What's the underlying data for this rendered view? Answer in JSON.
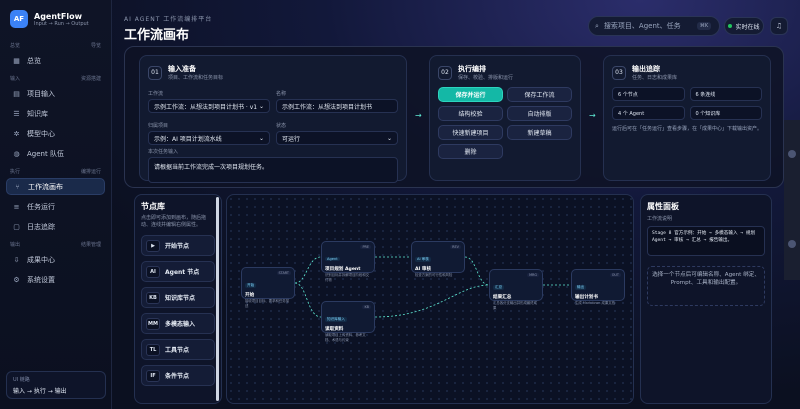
{
  "brand": {
    "logo": "AF",
    "name": "AgentFlow",
    "subtitle": "Input → Run → Output"
  },
  "nav": {
    "group1": {
      "label": "总览",
      "right": "导览"
    },
    "item_overview": "总览",
    "group2": {
      "label": "输入",
      "right": "资源搭建"
    },
    "item_project_input": "项目输入",
    "item_kb": "知识库",
    "item_models": "模型中心",
    "item_agents": "Agent 队伍",
    "group3": {
      "label": "执行",
      "right": "编排运行"
    },
    "item_canvas": "工作流画布",
    "item_tasks": "任务运行",
    "item_logs": "日志追踪",
    "group4": {
      "label": "输出",
      "right": "结果管理"
    },
    "item_results": "成果中心",
    "item_settings": "系统设置",
    "ui_box": {
      "label": "UI 链路",
      "value": "输入 → 执行 → 输出"
    }
  },
  "header": {
    "kicker": "AI AGENT 工作流编排平台",
    "title": "工作流画布",
    "search_placeholder": "搜索项目、Agent、任务",
    "kbd": "⌘K",
    "status": "实时在线"
  },
  "step1": {
    "num": "01",
    "title": "输入准备",
    "sub": "项目、工作流和任务目标",
    "workflow_label": "工作流",
    "workflow_value": "示例工作流：从想法到项目计划书 · v1",
    "name_label": "名称",
    "name_value": "示例工作流：从想法到项目计划书",
    "project_label": "归属项目",
    "project_value": "示例：AI 项目计划流水线",
    "state_label": "状态",
    "state_value": "可运行",
    "task_label": "本次任务输入",
    "task_value": "请根据当前工作流完成一次项目规划任务。"
  },
  "step2": {
    "num": "02",
    "title": "执行编排",
    "sub": "保存、校验、排版和运行",
    "buttons": [
      "保存并运行",
      "保存工作流",
      "结构校验",
      "自动排版",
      "快速新建项目",
      "新建草稿",
      "删除"
    ]
  },
  "step3": {
    "num": "03",
    "title": "输出追踪",
    "sub": "任务、日志和成果库",
    "stats": [
      "6 个节点",
      "6 条连线",
      "4 个 Agent",
      "0 个知识库"
    ],
    "note": "运行后可在「任务运行」查看步骤，在「成果中心」下载输出资产。"
  },
  "library": {
    "title": "节点库",
    "desc": "点击即可添加到画布，随后拖动、连线并编辑右侧属性。",
    "items": [
      {
        "icon": "▶",
        "label": "开始节点"
      },
      {
        "icon": "AI",
        "label": "Agent 节点"
      },
      {
        "icon": "KB",
        "label": "知识库节点"
      },
      {
        "icon": "MM",
        "label": "多模态输入"
      },
      {
        "icon": "TL",
        "label": "工具节点"
      },
      {
        "icon": "IF",
        "label": "条件节点"
      }
    ]
  },
  "canvas": {
    "nodes": [
      {
        "tag": "开始",
        "badge": "START",
        "title": "开始",
        "desc": "接收项目目标、要求和任务描述"
      },
      {
        "tag": "Agent",
        "badge": "PRE",
        "title": "项目规划 Agent",
        "desc": "识别目标并拆解项目阶段和交付物"
      },
      {
        "tag": "知识库输入",
        "badge": "KB",
        "title": "读取资料",
        "desc": "读取项目上传资料、参考文档、术语与约束"
      },
      {
        "tag": "AI 审核",
        "badge": "REV",
        "title": "AI 审核",
        "desc": "检查方案的可行性和风险"
      },
      {
        "tag": "汇总",
        "badge": "MRG",
        "title": "结果汇总",
        "desc": "汇总各分支输出并形成最终成果"
      },
      {
        "tag": "输出",
        "badge": "OUT",
        "title": "输出计划书",
        "desc": "生成 Markdown 成果文档"
      }
    ]
  },
  "props": {
    "title": "属性面板",
    "sub": "工作流说明",
    "code": "Stage 8 官方示例：开始 → 多模态输入 → 规划 Agent → 审核 → 汇总 → 报告输出。",
    "empty": "选择一个节点后可编辑名称、Agent 绑定、Prompt、工具和输出配置。"
  },
  "colors": {
    "accent": "#14b8a6",
    "brand": "#3b82f6",
    "online": "#22c55e"
  }
}
